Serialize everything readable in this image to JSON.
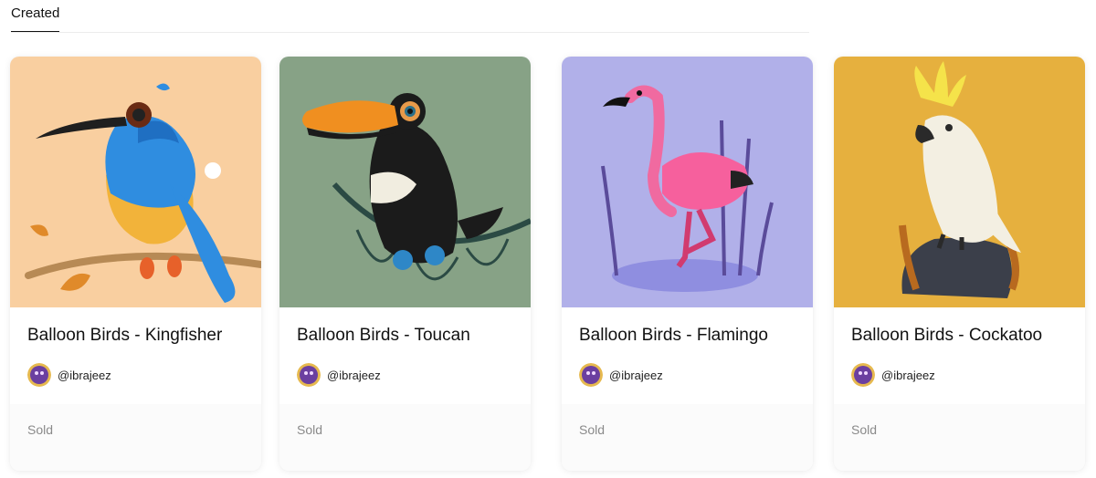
{
  "tabs": {
    "active_label": "Created"
  },
  "cards": [
    {
      "title": "Balloon Birds - Kingfisher",
      "creator": "@ibrajeez",
      "status": "Sold",
      "bg": "#f9cfa0"
    },
    {
      "title": "Balloon Birds - Toucan",
      "creator": "@ibrajeez",
      "status": "Sold",
      "bg": "#87a286"
    },
    {
      "title": "Balloon Birds - Flamingo",
      "creator": "@ibrajeez",
      "status": "Sold",
      "bg": "#b1b0e9"
    },
    {
      "title": "Balloon Birds - Cockatoo",
      "creator": "@ibrajeez",
      "status": "Sold",
      "bg": "#e6b03e"
    }
  ],
  "colors": {
    "avatar": "#6b3fa0",
    "muted_text": "#8a8a8a",
    "tab_underline": "#111111"
  },
  "icons": {
    "avatar": "creator-avatar"
  }
}
